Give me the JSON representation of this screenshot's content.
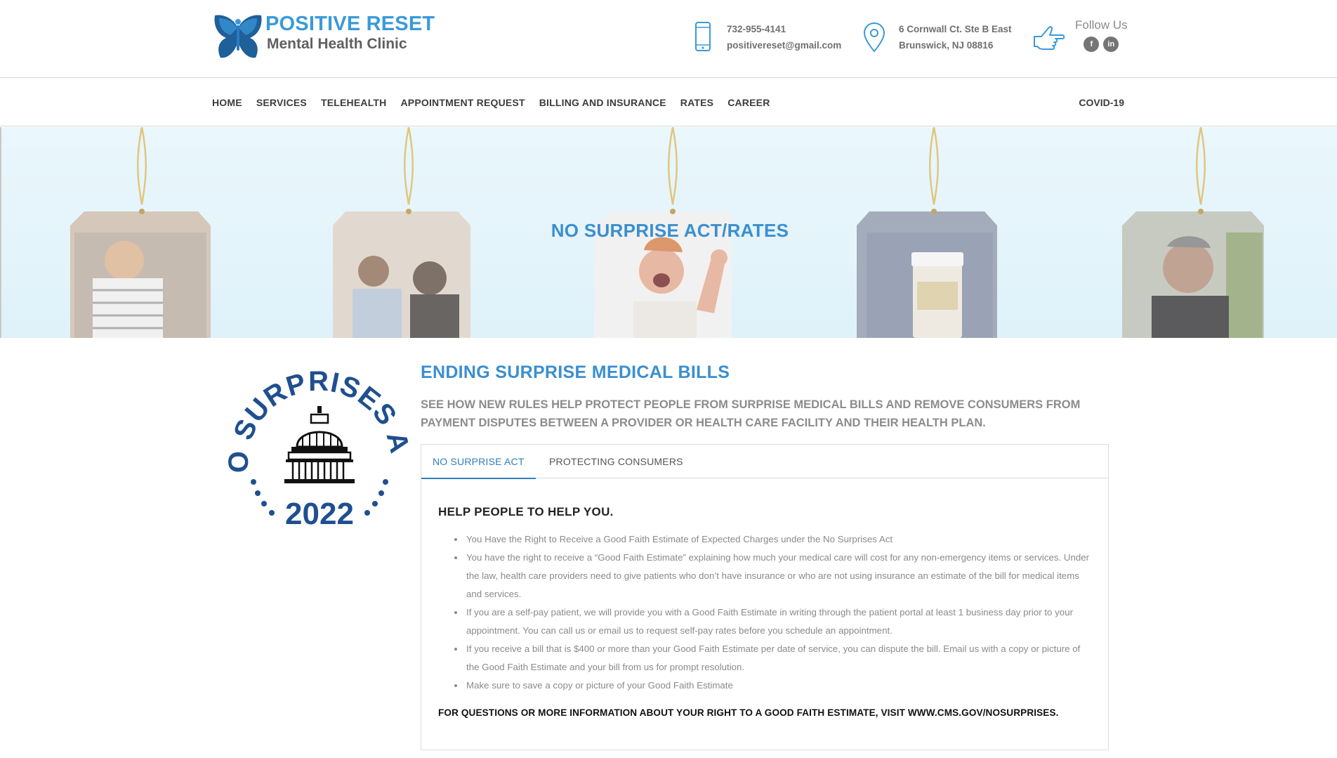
{
  "brand": {
    "title": "POSITIVE RESET",
    "subtitle": "Mental Health Clinic",
    "logo_icon": "butterfly-icon",
    "accent_color": "#3a9ad9"
  },
  "contact": {
    "phone": "732-955-4141",
    "email": "positivereset@gmail.com",
    "address_line1": "6 Cornwall Ct. Ste B East",
    "address_line2": "Brunswick, NJ 08816",
    "follow_label": "Follow Us",
    "social": [
      {
        "icon": "facebook-icon",
        "glyph": "f"
      },
      {
        "icon": "linkedin-icon",
        "glyph": "in"
      }
    ]
  },
  "nav": {
    "items": [
      "HOME",
      "SERVICES",
      "TELEHEALTH",
      "APPOINTMENT REQUEST",
      "BILLING AND INSURANCE",
      "RATES",
      "CAREER"
    ],
    "right_item": "COVID-19"
  },
  "banner": {
    "title": "NO SURPRISE ACT/RATES"
  },
  "seal": {
    "text_top": "NO SURPRISES ACT",
    "year": "2022"
  },
  "main": {
    "heading": "ENDING SURPRISE MEDICAL BILLS",
    "subheading": "SEE HOW NEW RULES HELP PROTECT PEOPLE FROM SURPRISE MEDICAL BILLS AND REMOVE CONSUMERS FROM PAYMENT DISPUTES BETWEEN A PROVIDER OR HEALTH CARE FACILITY AND THEIR HEALTH PLAN.",
    "tabs": [
      {
        "label": "NO SURPRISE ACT",
        "active": true
      },
      {
        "label": "PROTECTING CONSUMERS",
        "active": false
      }
    ],
    "panel_title": "HELP PEOPLE TO HELP YOU.",
    "bullets": [
      "You Have the Right to Receive a Good Faith Estimate of Expected Charges under the No Surprises Act",
      "You have the right to receive a “Good Faith Estimate” explaining how much your medical care will cost for any non-emergency items or services. Under the law, health care providers need to give patients who don’t have insurance or who are not using insurance an estimate of the bill for medical items and services.",
      "If you are a self-pay patient, we will provide you with a Good Faith Estimate in writing through the patient portal at least 1 business day prior to your appointment. You can call us or email us to request self-pay rates before you schedule an appointment.",
      "If you receive a bill that is $400 or more than your Good Faith Estimate per date of service, you can dispute the bill. Email us with a copy or picture of the Good Faith Estimate and your bill from us for prompt resolution.",
      "Make sure to save a copy or picture of your Good Faith Estimate"
    ],
    "footer_note": "FOR QUESTIONS OR MORE INFORMATION ABOUT YOUR RIGHT TO A GOOD FAITH ESTIMATE, VISIT WWW.CMS.GOV/NOSURPRISES."
  }
}
